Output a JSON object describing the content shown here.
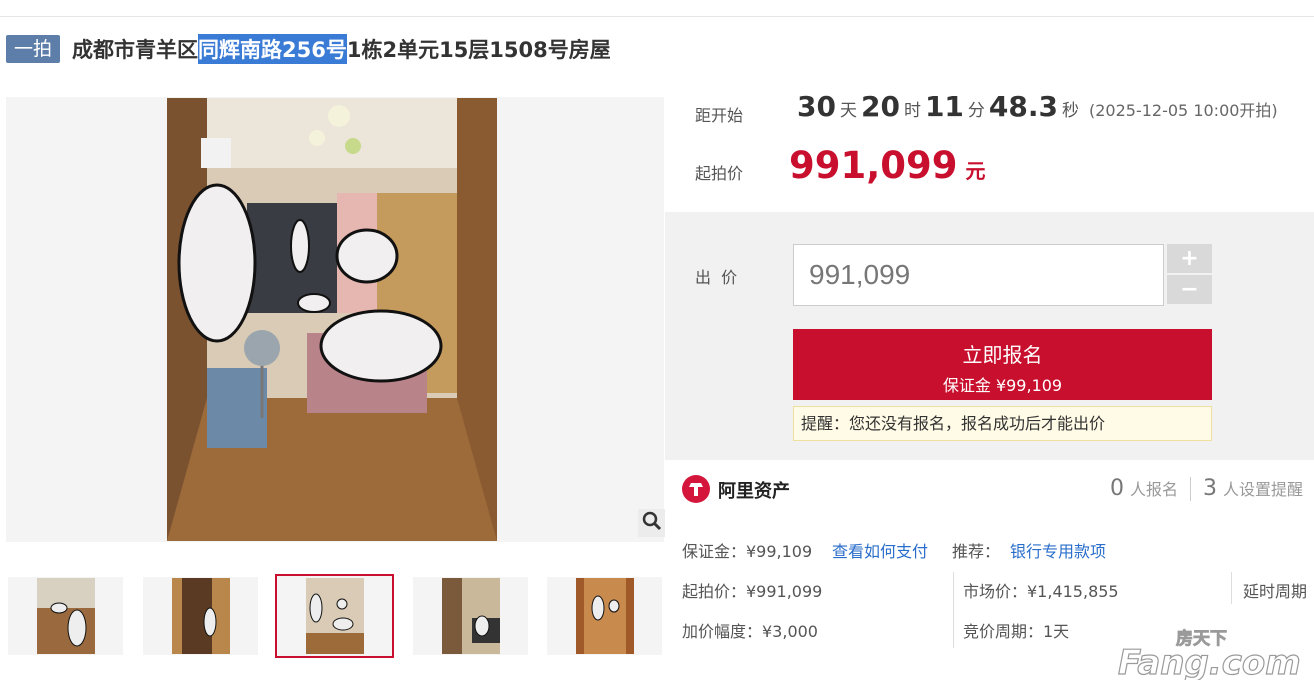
{
  "header": {
    "badge": "一拍",
    "title_pre": "成都市青羊区",
    "title_highlight": "同辉南路256号",
    "title_post": "1栋2单元15层1508号房屋"
  },
  "countdown": {
    "label": "距开始",
    "days": "30",
    "days_unit": "天",
    "hours": "20",
    "hours_unit": "时",
    "minutes": "11",
    "minutes_unit": "分",
    "seconds": "48.3",
    "seconds_unit": "秒",
    "start_time": "(2025-12-05 10:00开拍)"
  },
  "start_price": {
    "label": "起拍价",
    "value": "991,099",
    "unit": "元"
  },
  "bid": {
    "label": "出  价",
    "input_value": "991,099",
    "plus": "+",
    "minus": "−",
    "signup_label": "立即报名",
    "deposit_line": "保证金 ¥99,109",
    "notice": "提醒：您还没有报名，报名成功后才能出价"
  },
  "org": {
    "name": "阿里资产",
    "signup_count": "0",
    "signup_label": "人报名",
    "reminder_count": "3",
    "reminder_label": "人设置提醒"
  },
  "details": {
    "deposit": "保证金：¥99,109",
    "how_to_pay": "查看如何支付",
    "recommend_label": "推荐：",
    "recommend_link": "银行专用款项",
    "start_price": "起拍价：¥991,099",
    "market_price": "市场价：¥1,415,855",
    "delay_period": "延时周期",
    "increment": "加价幅度：¥3,000",
    "bid_period": "竞价周期：1天"
  },
  "watermark": {
    "text_cn": "房天下",
    "text_en": "Fang.com"
  },
  "colors": {
    "accent_red": "#c8102e",
    "badge_blue": "#5c7ea8",
    "link_blue": "#2a6ecb",
    "highlight": "#3a7bd5"
  }
}
